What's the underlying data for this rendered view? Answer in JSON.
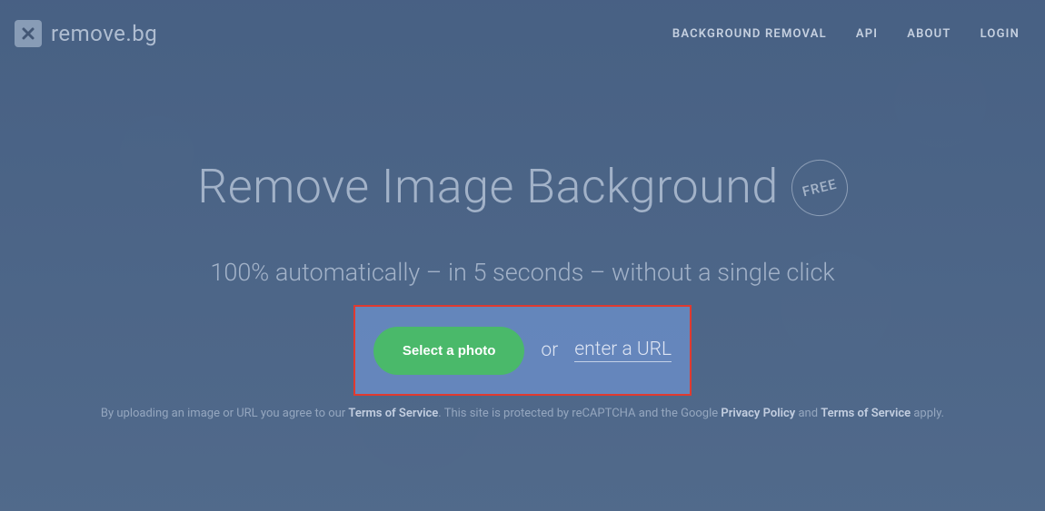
{
  "header": {
    "logo_text": "remove.bg",
    "nav": {
      "background_removal": "BACKGROUND REMOVAL",
      "api": "API",
      "about": "ABOUT",
      "login": "LOGIN"
    }
  },
  "hero": {
    "title": "Remove Image Background",
    "badge": "FREE",
    "subtitle": "100% automatically – in 5 seconds – without a single click"
  },
  "upload": {
    "select_button": "Select a photo",
    "or_text": "or",
    "url_link": "enter a URL"
  },
  "legal": {
    "prefix": "By uploading an image or URL you agree to our ",
    "tos1": "Terms of Service",
    "middle": ". This site is protected by reCAPTCHA and the Google ",
    "privacy": "Privacy Policy",
    "and": " and ",
    "tos2": "Terms of Service",
    "suffix": " apply."
  }
}
